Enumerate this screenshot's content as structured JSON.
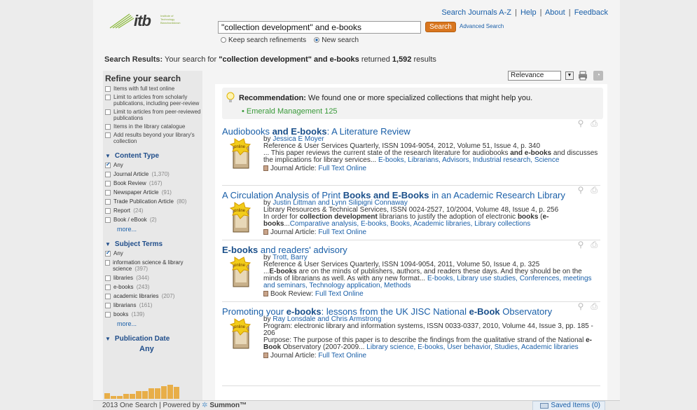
{
  "header": {
    "logo_text": "itb",
    "logo_subtext": "Institute of Technology Blanchardstown",
    "links": [
      "Search Journals A-Z",
      "Help",
      "About",
      "Feedback"
    ],
    "search_value": "\"collection development\" and e-books",
    "search_button": "Search",
    "advanced_search": "Advanced Search",
    "radio_keep": "Keep search refinements",
    "radio_new": "New search"
  },
  "summary": {
    "label": "Search Results:",
    "text_before": " Your search for ",
    "query": "\"collection development\" and e-books",
    "text_mid": " returned ",
    "count": "1,592",
    "text_after": " results"
  },
  "sort": {
    "selected": "Relevance"
  },
  "sidebar": {
    "title": "Refine your search",
    "options": [
      "Items with full text online",
      "Limit to articles from scholarly publications, including peer-review",
      "Limit to articles from peer-reviewed publications",
      "Items in the library catalogue",
      "Add results beyond your library's collection"
    ],
    "content_type": {
      "title": "Content Type",
      "items": [
        {
          "label": "Any",
          "count": "",
          "checked": true
        },
        {
          "label": "Journal Article",
          "count": "(1,370)"
        },
        {
          "label": "Book Review",
          "count": "(167)"
        },
        {
          "label": "Newspaper Article",
          "count": "(91)"
        },
        {
          "label": "Trade Publication Article",
          "count": "(80)"
        },
        {
          "label": "Report",
          "count": "(24)"
        },
        {
          "label": "Book / eBook",
          "count": "(2)"
        }
      ],
      "more": "more..."
    },
    "subject_terms": {
      "title": "Subject Terms",
      "items": [
        {
          "label": "Any",
          "count": "",
          "checked": true
        },
        {
          "label": "information science & library science",
          "count": "(397)"
        },
        {
          "label": "libraries",
          "count": "(344)"
        },
        {
          "label": "e-books",
          "count": "(243)"
        },
        {
          "label": "academic libraries",
          "count": "(207)"
        },
        {
          "label": "librarians",
          "count": "(161)"
        },
        {
          "label": "books",
          "count": "(139)"
        }
      ],
      "more": "more..."
    },
    "publication_date": {
      "title": "Publication Date",
      "value": "Any"
    }
  },
  "recommendation": {
    "label": "Recommendation:",
    "text": " We found one or more specialized collections that might help you.",
    "collection": "Emerald Management 125"
  },
  "results": [
    {
      "title_html": "Audiobooks <b>and E-books</b>: A Literature Review",
      "authors": "Jessica E Moyer",
      "source": "Reference & User Services Quarterly, ISSN 1094-9054, 2012, Volume 51, Issue 4, p. 340",
      "snippet_html": "... This paper reviews the current state of the research literature for audiobooks <b>and e-books</b> and discusses the implications for library services... ",
      "subjects": "E-books, Librarians, Advisors, Industrial research, Science",
      "type": "Journal Article:",
      "fulltext": "Full Text Online"
    },
    {
      "title_html": "A Circulation Analysis of Print <b>Books and E-Books</b> in an Academic Research Library",
      "authors": "Justin Littman and Lynn Silipigni Connaway",
      "source": "Library Resources & Technical Services, ISSN 0024-2527, 10/2004, Volume 48, Issue 4, p. 256",
      "snippet_html": "In order for <b>collection development</b> librarians to justify the adoption of electronic <b>books</b> (<b>e-books</b>...",
      "subjects": "Comparative analysis, E-books, Books, Academic libraries, Library collections",
      "type": "Journal Article:",
      "fulltext": "Full Text Online"
    },
    {
      "title_html": "<b>E-books</b> and readers' advisory",
      "authors": "Trott, Barry",
      "source": "Reference & User Services Quarterly, ISSN 1094-9054, 2011, Volume 50, Issue 4, p. 325",
      "snippet_html": "...<b>E-books</b> are on the minds of publishers, authors, and readers these days. And they should be on the minds of librarians as well. As with any new format... ",
      "subjects": "E-books, Library use studies, Conferences, meetings and seminars, Technology application, Methods",
      "type": "Book Review:",
      "fulltext": "Full Text Online"
    },
    {
      "title_html": "Promoting your <b>e-books</b>: lessons from the UK JISC National <b>e-Book</b> Observatory",
      "authors": "Ray Lonsdale and Chris Armstrong",
      "source": "Program: electronic library and information systems, ISSN 0033-0337, 2010, Volume 44, Issue 3, pp. 185 - 206",
      "snippet_html": "Purpose: The purpose of this paper is to describe the findings from the qualitative strand of the National <b>e-Book</b> Observatory (2007-2009... ",
      "subjects": "Library science, E-books, User behavior, Studies, Academic libraries",
      "type": "Journal Article:",
      "fulltext": "Full Text Online"
    }
  ],
  "footer": {
    "text": "2013 One Search | Powered by",
    "brand": "Summon™",
    "saved": "Saved Items (0)"
  },
  "colors": {
    "accent": "#d9761e",
    "link": "#1a5fa8",
    "green": "#3a9a3a"
  },
  "histogram_relative_heights": [
    0.4,
    0.2,
    0.2,
    0.35,
    0.35,
    0.55,
    0.55,
    0.75,
    0.75,
    0.9,
    1.0,
    0.85
  ]
}
